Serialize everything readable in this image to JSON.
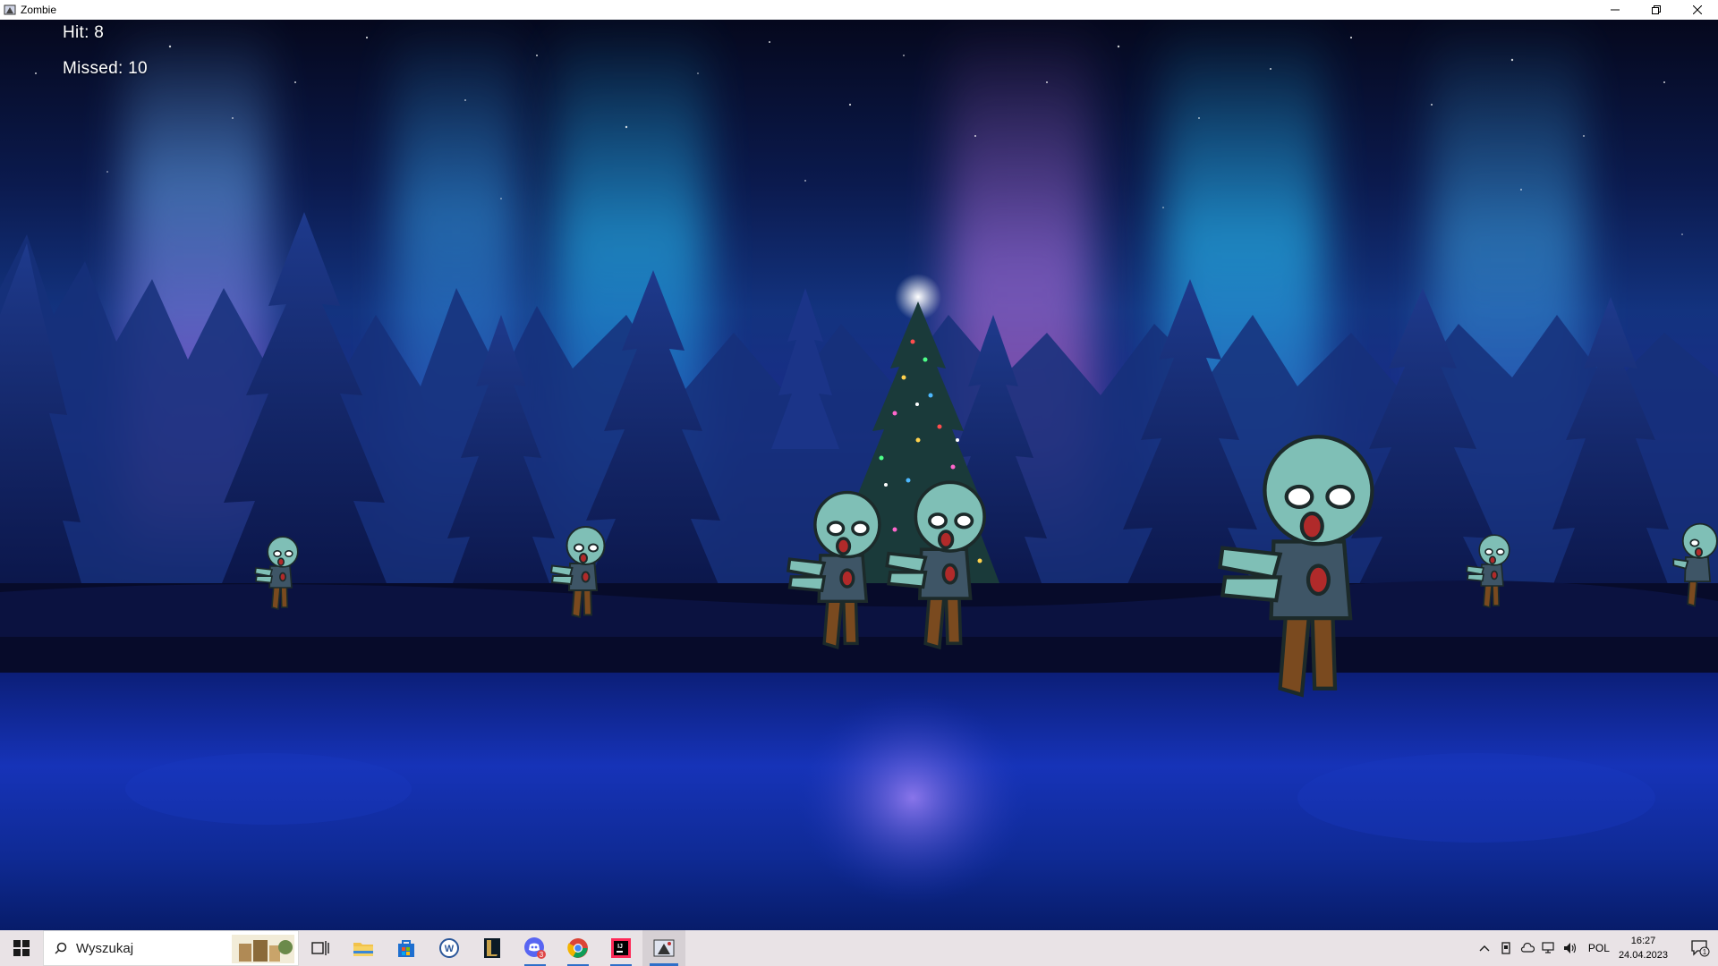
{
  "window": {
    "title": "Zombie"
  },
  "hud": {
    "hit_text": "Hit: 8",
    "missed_text": "Missed: 10",
    "hit": 8,
    "missed": 10
  },
  "zombies": [
    {
      "id": "zombie-1",
      "depth": "far"
    },
    {
      "id": "zombie-2",
      "depth": "far"
    },
    {
      "id": "zombie-3",
      "depth": "mid"
    },
    {
      "id": "zombie-4",
      "depth": "mid"
    },
    {
      "id": "zombie-5",
      "depth": "near"
    },
    {
      "id": "zombie-6",
      "depth": "far"
    },
    {
      "id": "zombie-7",
      "depth": "far"
    }
  ],
  "taskbar": {
    "search_placeholder": "Wyszukaj",
    "apps": [
      "windows-start",
      "task-view",
      "file-explorer",
      "microsoft-store",
      "word",
      "league-of-legends",
      "discord",
      "chrome",
      "jetbrains-ide",
      "zombie-game"
    ],
    "discord_badge": "3",
    "language": "POL",
    "time": "16:27",
    "date": "24.04.2023",
    "notification_count": "1"
  },
  "colors": {
    "zombie_skin": "#7fbfb6",
    "shirt": "#3e5566",
    "pants": "#7a4a1f",
    "taskbar_bg": "#e9e3e6",
    "accent": "#2f6fc9"
  }
}
